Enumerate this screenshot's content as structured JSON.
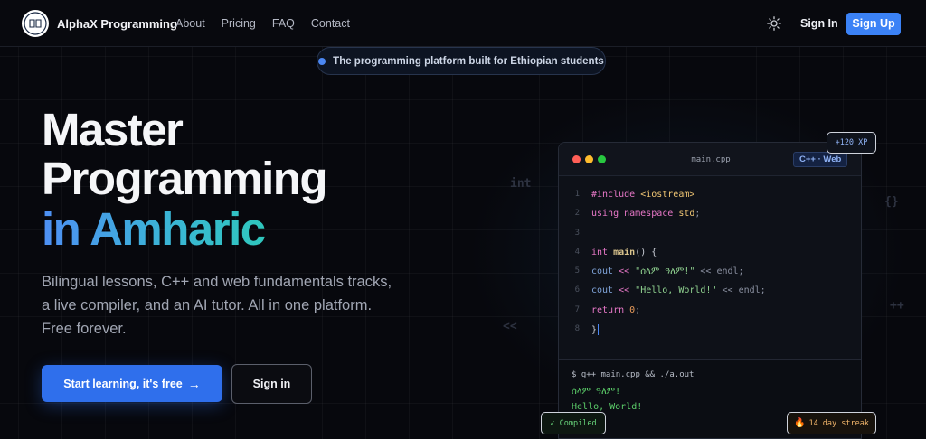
{
  "nav": {
    "brand": "AlphaX Programming",
    "links": [
      "About",
      "Pricing",
      "FAQ",
      "Contact"
    ],
    "sign_in": "Sign In",
    "sign_up": "Sign Up"
  },
  "banner": "The programming platform built for Ethiopian students",
  "hero": {
    "line1": "Master",
    "line2": "Programming",
    "line3": "in Amharic",
    "description": "Bilingual lessons, C++ and web fundamentals tracks, a live compiler, and an AI tutor. All in one platform. Free forever.",
    "cta_primary": "Start learning, it's free",
    "cta_secondary": "Sign in"
  },
  "decor": {
    "int": "int",
    "braces": "{}",
    "shift": "<<",
    "plus": "++"
  },
  "editor": {
    "filename": "main.cpp",
    "badge": "C++ · Web",
    "line_numbers": [
      "1",
      "2",
      "3",
      "4",
      "5",
      "6",
      "7",
      "8"
    ],
    "code": {
      "l1_kw": "#include ",
      "l1_lib": "<iostream>",
      "l2_kw": "using namespace ",
      "l2_ns": "std",
      "l2_end": ";",
      "l4_type": "int ",
      "l4_fn": "main",
      "l4_end": "() {",
      "l5_fn": "cout ",
      "l5_op": "<< ",
      "l5_str": "\"ሰላም ዓለም!\"",
      "l5_end": " << endl;",
      "l6_fn": "cout ",
      "l6_op": "<< ",
      "l6_str": "\"Hello, World!\"",
      "l6_end": " << endl;",
      "l7_kw": "return ",
      "l7_num": "0",
      "l7_end": ";",
      "l8": "}"
    },
    "terminal": {
      "command": "$ g++ main.cpp && ./a.out",
      "out1": "ሰላም ዓለም!",
      "out2": "Hello, World!"
    }
  },
  "badges": {
    "xp": "+120 XP",
    "compiled": "✓ Compiled",
    "streak": "14 day streak"
  },
  "colors": {
    "accent": "#3b82f6",
    "gradient_start": "#4e8ff4",
    "gradient_end": "#2fc7bd",
    "dot_red": "#ff5f57",
    "dot_yellow": "#febc2e",
    "dot_green": "#28c840"
  }
}
